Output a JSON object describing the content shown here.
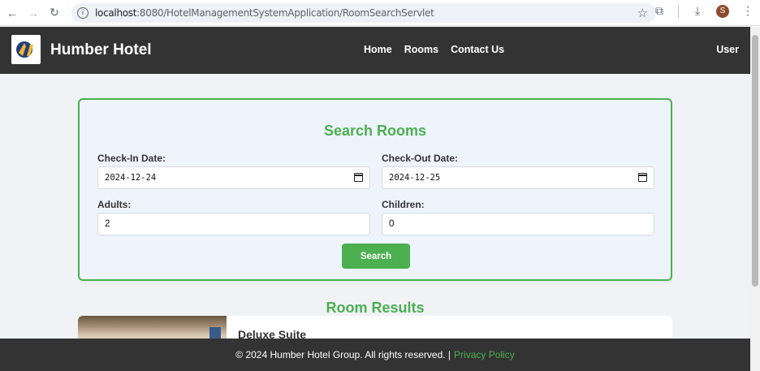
{
  "browser": {
    "url_host": "localhost",
    "url_path": ":8080/HotelManagementSystemApplication/RoomSearchServlet",
    "profile_initial": "S"
  },
  "header": {
    "brand": "Humber Hotel",
    "nav": [
      "Home",
      "Rooms",
      "Contact Us"
    ],
    "user_link": "User"
  },
  "search": {
    "title": "Search Rooms",
    "checkin_label": "Check-In Date:",
    "checkin_value": "2024-12-24",
    "checkout_label": "Check-Out Date:",
    "checkout_value": "2024-12-25",
    "adults_label": "Adults:",
    "adults_value": "2",
    "children_label": "Children:",
    "children_value": "0",
    "button_label": "Search"
  },
  "results": {
    "title": "Room Results",
    "rooms": [
      {
        "name": "Deluxe Suite"
      }
    ]
  },
  "footer": {
    "copyright": "© 2024 Humber Hotel Group. All rights reserved. |",
    "privacy_link": "Privacy Policy"
  },
  "colors": {
    "accent": "#4caf50",
    "header_bg": "#333333",
    "page_bg": "#f0f2f5",
    "card_bg": "#eef4fb"
  }
}
